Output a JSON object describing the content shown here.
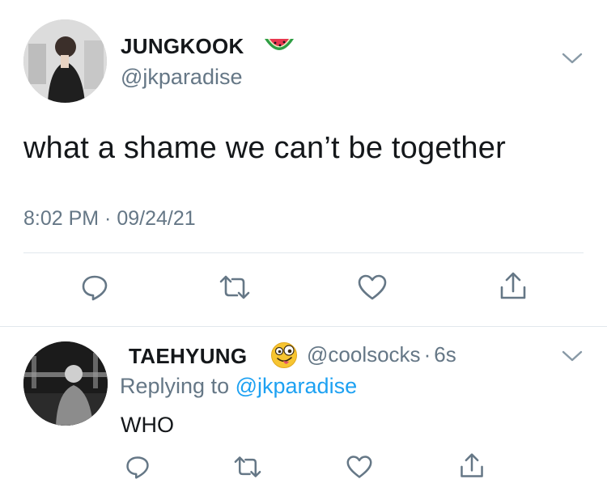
{
  "main_tweet": {
    "author_name": "JUNGKOOK",
    "name_emoji": "watermelon-emoji",
    "handle": "@jkparadise",
    "text": "what a shame we can’t be together",
    "timestamp": "8:02 PM · 09/24/21",
    "actions": [
      "reply-icon",
      "retweet-icon",
      "like-icon",
      "share-icon"
    ]
  },
  "reply_tweet": {
    "author_name": "TAEHYUNG",
    "name_emoji": "zany-face-emoji",
    "handle": "@coolsocks",
    "separator": "·",
    "time_ago": "6s",
    "replying_label": "Replying to",
    "replying_handle": "@jkparadise",
    "text": "WHO",
    "actions": [
      "reply-icon",
      "retweet-icon",
      "like-icon",
      "share-icon"
    ]
  },
  "colors": {
    "text": "#14171a",
    "secondary": "#657786",
    "accent": "#1da1f2",
    "divider": "#e1e8ed"
  }
}
